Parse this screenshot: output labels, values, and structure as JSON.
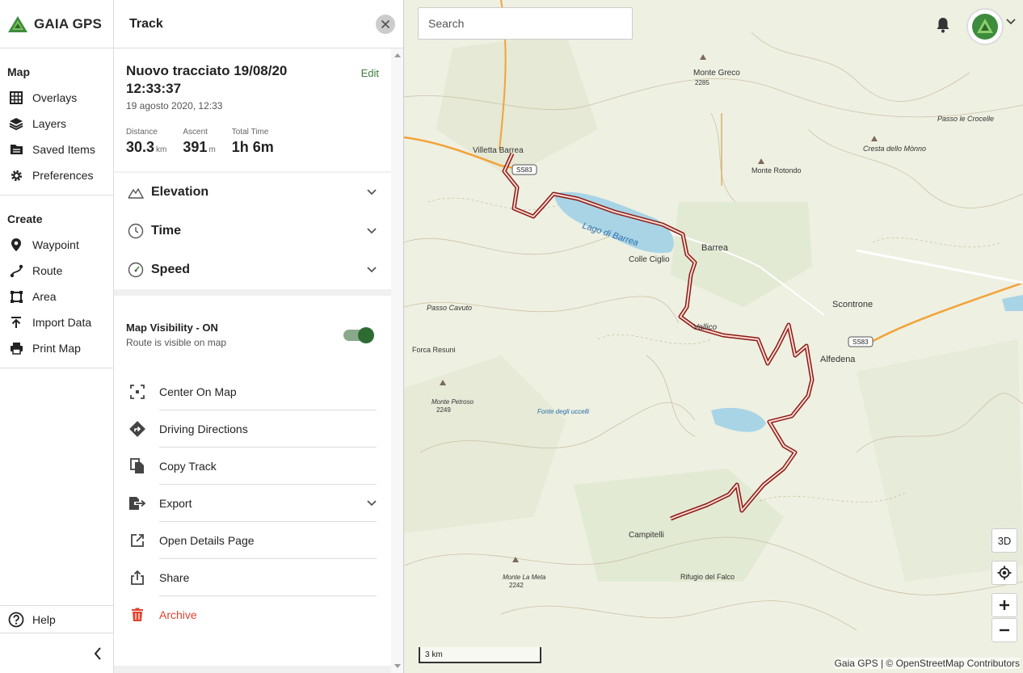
{
  "brand": {
    "name": "GAIA GPS"
  },
  "nav": {
    "map_title": "Map",
    "map_items": [
      {
        "label": "Overlays",
        "icon": "grid-icon"
      },
      {
        "label": "Layers",
        "icon": "layers-icon"
      },
      {
        "label": "Saved Items",
        "icon": "folder-icon"
      },
      {
        "label": "Preferences",
        "icon": "gear-icon"
      }
    ],
    "create_title": "Create",
    "create_items": [
      {
        "label": "Waypoint",
        "icon": "pin-icon"
      },
      {
        "label": "Route",
        "icon": "route-icon"
      },
      {
        "label": "Area",
        "icon": "area-icon"
      },
      {
        "label": "Import Data",
        "icon": "upload-icon"
      },
      {
        "label": "Print Map",
        "icon": "printer-icon"
      }
    ],
    "help_label": "Help"
  },
  "panel": {
    "title": "Track",
    "track_name": "Nuovo tracciato 19/08/20 12:33:37",
    "track_date": "19 agosto 2020, 12:33",
    "edit_label": "Edit",
    "stats": [
      {
        "label": "Distance",
        "value": "30.3",
        "unit": "km"
      },
      {
        "label": "Ascent",
        "value": "391",
        "unit": "m"
      },
      {
        "label": "Total Time",
        "value": "1h 6m",
        "unit": ""
      }
    ],
    "sections": [
      "Elevation",
      "Time",
      "Speed"
    ],
    "visibility_title": "Map Visibility - ON",
    "visibility_sub": "Route is visible on map",
    "visibility_on": true,
    "actions": [
      "Center On Map",
      "Driving Directions",
      "Copy Track",
      "Export",
      "Open Details Page",
      "Share",
      "Archive"
    ]
  },
  "map": {
    "search_placeholder": "Search",
    "btn_3d": "3D",
    "scale_label": "3 km",
    "attribution": "Gaia GPS | © OpenStreetMap Contributors",
    "labels": [
      "Villetta Barrea",
      "SS83",
      "Lago di Barrea",
      "Barrea",
      "Colle Ciglio",
      "Monte Greco",
      "2285",
      "Monte Rotondo",
      "Cresta dello Mònno",
      "Passo le Crocelle",
      "Scontrone",
      "Alfedena",
      "SS83",
      "Vallico",
      "Passo Cavuto",
      "Forca Resuni",
      "Monte Petroso",
      "2249",
      "Fonte degli uccelli",
      "Campitelli",
      "Rifugio del Falco",
      "Monte La Meta",
      "2242"
    ],
    "colors": {
      "track": "#e03a2f",
      "road": "#f2a33a",
      "water": "#a8d4e6",
      "forest": "#dfe8cf"
    }
  }
}
